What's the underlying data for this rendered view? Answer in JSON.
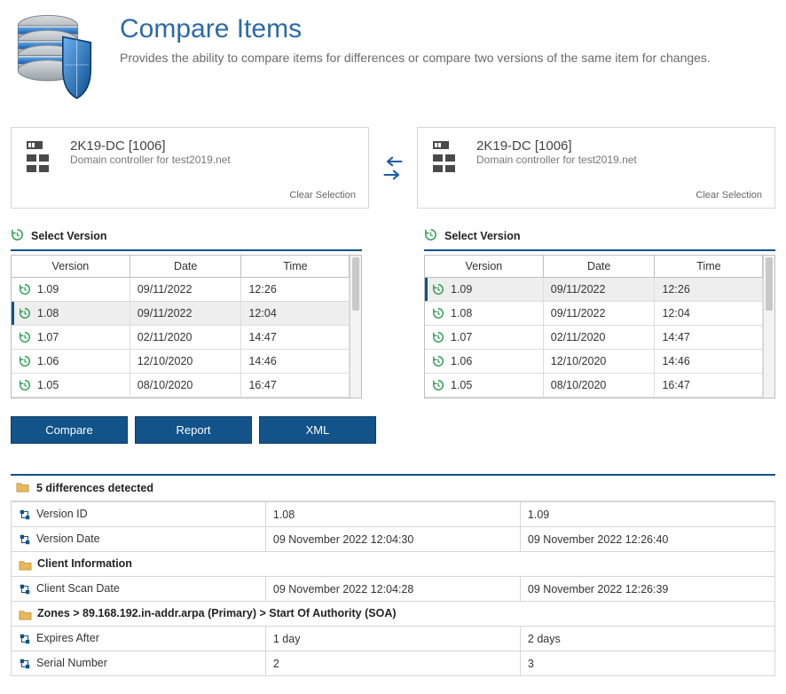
{
  "header": {
    "title": "Compare Items",
    "subtitle": "Provides the ability to compare items for differences or compare two versions of the same item for changes."
  },
  "cardLeft": {
    "title": "2K19-DC [1006]",
    "subtitle": "Domain controller for test2019.net",
    "clear": "Clear Selection"
  },
  "cardRight": {
    "title": "2K19-DC [1006]",
    "subtitle": "Domain controller for test2019.net",
    "clear": "Clear Selection"
  },
  "selectVersionLabel": "Select Version",
  "columns": {
    "version": "Version",
    "date": "Date",
    "time": "Time"
  },
  "leftVersions": [
    {
      "v": "1.09",
      "d": "09/11/2022",
      "t": "12:26"
    },
    {
      "v": "1.08",
      "d": "09/11/2022",
      "t": "12:04"
    },
    {
      "v": "1.07",
      "d": "02/11/2020",
      "t": "14:47"
    },
    {
      "v": "1.06",
      "d": "12/10/2020",
      "t": "14:46"
    },
    {
      "v": "1.05",
      "d": "08/10/2020",
      "t": "16:47"
    }
  ],
  "leftSelectedIndex": 1,
  "rightVersions": [
    {
      "v": "1.09",
      "d": "09/11/2022",
      "t": "12:26"
    },
    {
      "v": "1.08",
      "d": "09/11/2022",
      "t": "12:04"
    },
    {
      "v": "1.07",
      "d": "02/11/2020",
      "t": "14:47"
    },
    {
      "v": "1.06",
      "d": "12/10/2020",
      "t": "14:46"
    },
    {
      "v": "1.05",
      "d": "08/10/2020",
      "t": "16:47"
    }
  ],
  "rightSelectedIndex": 0,
  "buttons": {
    "compare": "Compare",
    "report": "Report",
    "xml": "XML"
  },
  "diffHeader": "5 differences detected",
  "diffRows": [
    {
      "type": "item",
      "label": "Version ID",
      "a": "1.08",
      "b": "1.09"
    },
    {
      "type": "item",
      "label": "Version Date",
      "a": "09 November 2022 12:04:30",
      "b": "09 November 2022 12:26:40"
    },
    {
      "type": "group",
      "label": "Client Information"
    },
    {
      "type": "item",
      "label": "Client Scan Date",
      "a": "09 November 2022 12:04:28",
      "b": "09 November 2022 12:26:39"
    },
    {
      "type": "group",
      "label": "Zones > 89.168.192.in-addr.arpa (Primary) > Start Of Authority (SOA)"
    },
    {
      "type": "item",
      "label": "Expires After",
      "a": "1 day",
      "b": "2 days"
    },
    {
      "type": "item",
      "label": "Serial Number",
      "a": "2",
      "b": "3"
    }
  ]
}
